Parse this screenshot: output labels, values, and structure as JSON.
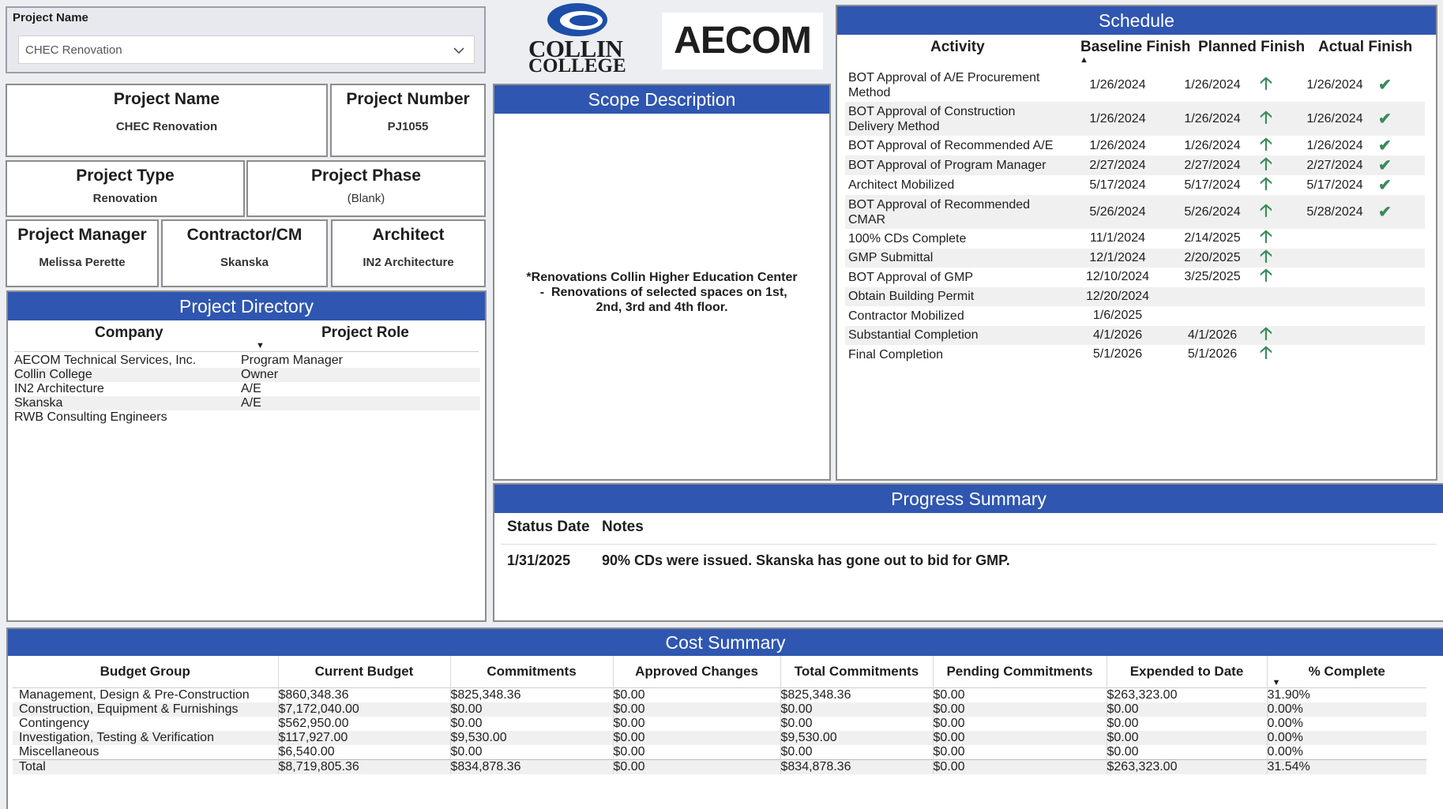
{
  "slicer": {
    "label": "Project Name",
    "value": "CHEC Renovation"
  },
  "logos": {
    "collin_top": "COLLIN",
    "collin_bottom": "COLLEGE",
    "aecom": "AECOM"
  },
  "cards": {
    "project_name": {
      "title": "Project Name",
      "value": "CHEC Renovation"
    },
    "project_number": {
      "title": "Project Number",
      "value": "PJ1055"
    },
    "project_type": {
      "title": "Project Type",
      "value": "Renovation"
    },
    "project_phase": {
      "title": "Project Phase",
      "value": "(Blank)"
    },
    "project_manager": {
      "title": "Project Manager",
      "value": "Melissa Perette"
    },
    "contractor": {
      "title": "Contractor/CM",
      "value": "Skanska"
    },
    "architect": {
      "title": "Architect",
      "value": "IN2 Architecture"
    }
  },
  "directory": {
    "title": "Project Directory",
    "col_company": "Company",
    "col_role": "Project Role",
    "rows": [
      {
        "company": "AECOM Technical Services, Inc.",
        "role": "Program Manager"
      },
      {
        "company": "Collin College",
        "role": "Owner"
      },
      {
        "company": "IN2 Architecture",
        "role": "A/E"
      },
      {
        "company": "Skanska",
        "role": "A/E"
      },
      {
        "company": "RWB Consulting Engineers",
        "role": ""
      }
    ]
  },
  "scope": {
    "title": "Scope Description",
    "line1": "*Renovations Collin Higher Education Center",
    "line2": " -  Renovations of selected spaces on 1st,",
    "line3": "2nd, 3rd and 4th floor."
  },
  "schedule": {
    "title": "Schedule",
    "col_activity": "Activity",
    "col_baseline": "Baseline Finish",
    "col_planned": "Planned Finish",
    "col_actual": "Actual Finish",
    "rows": [
      {
        "activity1": "BOT Approval of A/E Procurement",
        "activity2": "Method",
        "baseline": "1/26/2024",
        "planned": "1/26/2024",
        "actual": "1/26/2024",
        "arrow": true,
        "check": true
      },
      {
        "activity1": "BOT Approval of Construction",
        "activity2": "Delivery Method",
        "baseline": "1/26/2024",
        "planned": "1/26/2024",
        "actual": "1/26/2024",
        "arrow": true,
        "check": true
      },
      {
        "activity1": "BOT Approval of Recommended A/E",
        "activity2": "",
        "baseline": "1/26/2024",
        "planned": "1/26/2024",
        "actual": "1/26/2024",
        "arrow": true,
        "check": true
      },
      {
        "activity1": "BOT Approval of Program Manager",
        "activity2": "",
        "baseline": "2/27/2024",
        "planned": "2/27/2024",
        "actual": "2/27/2024",
        "arrow": true,
        "check": true
      },
      {
        "activity1": "Architect Mobilized",
        "activity2": "",
        "baseline": "5/17/2024",
        "planned": "5/17/2024",
        "actual": "5/17/2024",
        "arrow": true,
        "check": true
      },
      {
        "activity1": "BOT Approval of Recommended",
        "activity2": "CMAR",
        "baseline": "5/26/2024",
        "planned": "5/26/2024",
        "actual": "5/28/2024",
        "arrow": true,
        "check": true
      },
      {
        "activity1": "100% CDs Complete",
        "activity2": "",
        "baseline": "11/1/2024",
        "planned": "2/14/2025",
        "actual": "",
        "arrow": true,
        "check": false
      },
      {
        "activity1": "GMP Submittal",
        "activity2": "",
        "baseline": "12/1/2024",
        "planned": "2/20/2025",
        "actual": "",
        "arrow": true,
        "check": false
      },
      {
        "activity1": "BOT Approval of GMP",
        "activity2": "",
        "baseline": "12/10/2024",
        "planned": "3/25/2025",
        "actual": "",
        "arrow": true,
        "check": false
      },
      {
        "activity1": "Obtain Building Permit",
        "activity2": "",
        "baseline": "12/20/2024",
        "planned": "",
        "actual": "",
        "arrow": false,
        "check": false
      },
      {
        "activity1": "Contractor Mobilized",
        "activity2": "",
        "baseline": "1/6/2025",
        "planned": "",
        "actual": "",
        "arrow": false,
        "check": false
      },
      {
        "activity1": "Substantial Completion",
        "activity2": "",
        "baseline": "4/1/2026",
        "planned": "4/1/2026",
        "actual": "",
        "arrow": true,
        "check": false
      },
      {
        "activity1": "Final Completion",
        "activity2": "",
        "baseline": "5/1/2026",
        "planned": "5/1/2026",
        "actual": "",
        "arrow": true,
        "check": false
      }
    ]
  },
  "progress": {
    "title": "Progress Summary",
    "col_date": "Status Date",
    "col_notes": "Notes",
    "date": "1/31/2025",
    "note": "90% CDs were issued. Skanska has gone out to bid for GMP."
  },
  "cost": {
    "title": "Cost Summary",
    "headers": [
      "Budget Group",
      "Current Budget",
      "Commitments",
      "Approved Changes",
      "Total Commitments",
      "Pending Commitments",
      "Expended to Date",
      "% Complete"
    ],
    "rows": [
      [
        "Management, Design & Pre-Construction",
        "$860,348.36",
        "$825,348.36",
        "$0.00",
        "$825,348.36",
        "$0.00",
        "$263,323.00",
        "31.90%"
      ],
      [
        "Construction, Equipment & Furnishings",
        "$7,172,040.00",
        "$0.00",
        "$0.00",
        "$0.00",
        "$0.00",
        "$0.00",
        "0.00%"
      ],
      [
        "Contingency",
        "$562,950.00",
        "$0.00",
        "$0.00",
        "$0.00",
        "$0.00",
        "$0.00",
        "0.00%"
      ],
      [
        "Investigation, Testing & Verification",
        "$117,927.00",
        "$9,530.00",
        "$0.00",
        "$9,530.00",
        "$0.00",
        "$0.00",
        "0.00%"
      ],
      [
        "Miscellaneous",
        "$6,540.00",
        "$0.00",
        "$0.00",
        "$0.00",
        "$0.00",
        "$0.00",
        "0.00%"
      ]
    ],
    "total": [
      "Total",
      "$8,719,805.36",
      "$834,878.36",
      "$0.00",
      "$834,878.36",
      "$0.00",
      "$263,323.00",
      "31.54%"
    ]
  },
  "colors": {
    "header_blue": "#2f56b0",
    "check_green": "#3a8a5b",
    "collin_blue": "#1d4fa8"
  }
}
